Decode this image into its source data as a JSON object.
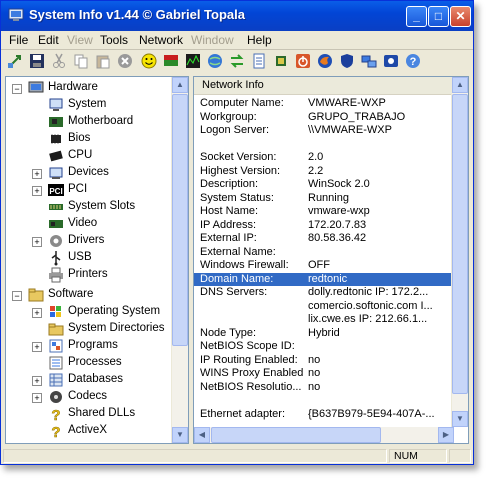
{
  "window": {
    "title": "System Info v1.44  © Gabriel Topala",
    "controls": {
      "minimize": "_",
      "maximize": "□",
      "close": "✕"
    }
  },
  "menu": [
    {
      "label": "File",
      "enabled": true
    },
    {
      "label": "Edit",
      "enabled": true
    },
    {
      "label": "View",
      "enabled": false
    },
    {
      "label": "Tools",
      "enabled": true
    },
    {
      "label": "Network",
      "enabled": true
    },
    {
      "label": "Window",
      "enabled": false
    },
    {
      "label": "Help",
      "enabled": true
    }
  ],
  "toolbar": [
    "refresh-icon",
    "save-icon",
    "cut-icon",
    "copy-icon",
    "paste-icon",
    "stop-icon",
    "smiley-icon",
    "flag-icon",
    "monitor-icon",
    "chart-icon",
    "globe-icon",
    "swap-icon",
    "document-icon",
    "cpu-icon",
    "power-icon",
    "firefox-icon",
    "shield-icon",
    "network-icon",
    "drive-icon",
    "camera-icon",
    "help-icon"
  ],
  "tree": {
    "hardware": {
      "label": "Hardware",
      "items": [
        {
          "label": "System",
          "icon": "system-icon"
        },
        {
          "label": "Motherboard",
          "icon": "motherboard-icon"
        },
        {
          "label": "Bios",
          "icon": "bios-chip-icon"
        },
        {
          "label": "CPU",
          "icon": "cpu-icon"
        },
        {
          "label": "Devices",
          "icon": "devices-icon"
        },
        {
          "label": "PCI",
          "icon": "pci-icon"
        },
        {
          "label": "System Slots",
          "icon": "slots-icon"
        },
        {
          "label": "Video",
          "icon": "video-icon"
        },
        {
          "label": "Drivers",
          "icon": "drivers-icon"
        },
        {
          "label": "USB",
          "icon": "usb-icon"
        },
        {
          "label": "Printers",
          "icon": "printer-icon"
        }
      ]
    },
    "software": {
      "label": "Software",
      "items": [
        {
          "label": "Operating System",
          "icon": "windows-icon"
        },
        {
          "label": "System Directories",
          "icon": "folder-icon"
        },
        {
          "label": "Programs",
          "icon": "programs-icon"
        },
        {
          "label": "Processes",
          "icon": "processes-icon"
        },
        {
          "label": "Databases",
          "icon": "database-icon"
        },
        {
          "label": "Codecs",
          "icon": "codecs-icon"
        },
        {
          "label": "Shared DLLs",
          "icon": "question-icon"
        },
        {
          "label": "ActiveX",
          "icon": "question-icon"
        }
      ]
    }
  },
  "info": {
    "header": "Network Info",
    "rows": [
      {
        "k": "Computer Name:",
        "v": "VMWARE-WXP"
      },
      {
        "k": "Workgroup:",
        "v": "GRUPO_TRABAJO"
      },
      {
        "k": "Logon Server:",
        "v": "\\\\VMWARE-WXP"
      },
      {
        "k": "",
        "v": ""
      },
      {
        "k": "Socket Version:",
        "v": "2.0"
      },
      {
        "k": "Highest Version:",
        "v": "2.2"
      },
      {
        "k": "Description:",
        "v": "WinSock 2.0"
      },
      {
        "k": "System Status:",
        "v": "Running"
      },
      {
        "k": "Host Name:",
        "v": "vmware-wxp"
      },
      {
        "k": "IP Address:",
        "v": "172.20.7.83"
      },
      {
        "k": "External IP:",
        "v": "80.58.36.42"
      },
      {
        "k": "External Name:",
        "v": ""
      },
      {
        "k": "Windows Firewall:",
        "v": "OFF"
      },
      {
        "k": "Domain Name:",
        "v": "redtonic",
        "selected": true
      },
      {
        "k": "DNS Servers:",
        "v": "dolly.redtonic IP: 172.2..."
      },
      {
        "k": "",
        "v": "comercio.softonic.com I..."
      },
      {
        "k": "",
        "v": "lix.cwe.es IP: 212.66.1..."
      },
      {
        "k": "Node Type:",
        "v": "Hybrid"
      },
      {
        "k": "NetBIOS Scope ID:",
        "v": ""
      },
      {
        "k": "IP Routing Enabled:",
        "v": "no"
      },
      {
        "k": "WINS Proxy Enabled:",
        "v": "no"
      },
      {
        "k": "NetBIOS Resolutio...",
        "v": "no"
      },
      {
        "k": "",
        "v": ""
      },
      {
        "k": "Ethernet adapter:",
        "v": "{B637B979-5E94-407A-..."
      }
    ]
  },
  "status": {
    "num": "NUM"
  }
}
